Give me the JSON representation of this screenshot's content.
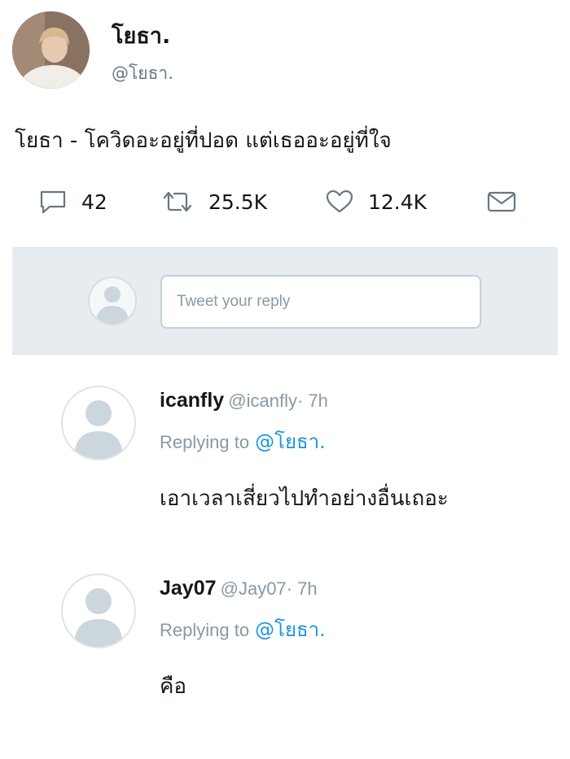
{
  "tweet": {
    "author_name": "โยธา.",
    "author_handle": "@โยธา.",
    "text": "โยธา - โควิดอะอยู่ที่ปอด แต่เธออะอยู่ที่ใจ",
    "reply_count": "42",
    "retweet_count": "25.5K",
    "like_count": "12.4K",
    "icons": [
      "reply-icon",
      "retweet-icon",
      "like-icon",
      "direct-message-icon"
    ]
  },
  "composer": {
    "placeholder": "Tweet your reply"
  },
  "replies": [
    {
      "name": "icanfly",
      "handle": "@icanfly",
      "time": "· 7h",
      "replying_label": "Replying to",
      "replying_to": "@โยธา.",
      "text": "เอาเวลาเสี่ยวไปทำอย่างอื่นเถอะ"
    },
    {
      "name": "Jay07",
      "handle": "@Jay07",
      "time": "· 7h",
      "replying_label": "Replying to",
      "replying_to": "@โยธา.",
      "text": "คือ"
    }
  ],
  "colors": {
    "text": "#14171a",
    "secondary": "#657786",
    "muted": "#8899a6",
    "link": "#1b95e0",
    "composer_bg": "#e6ecf0"
  }
}
